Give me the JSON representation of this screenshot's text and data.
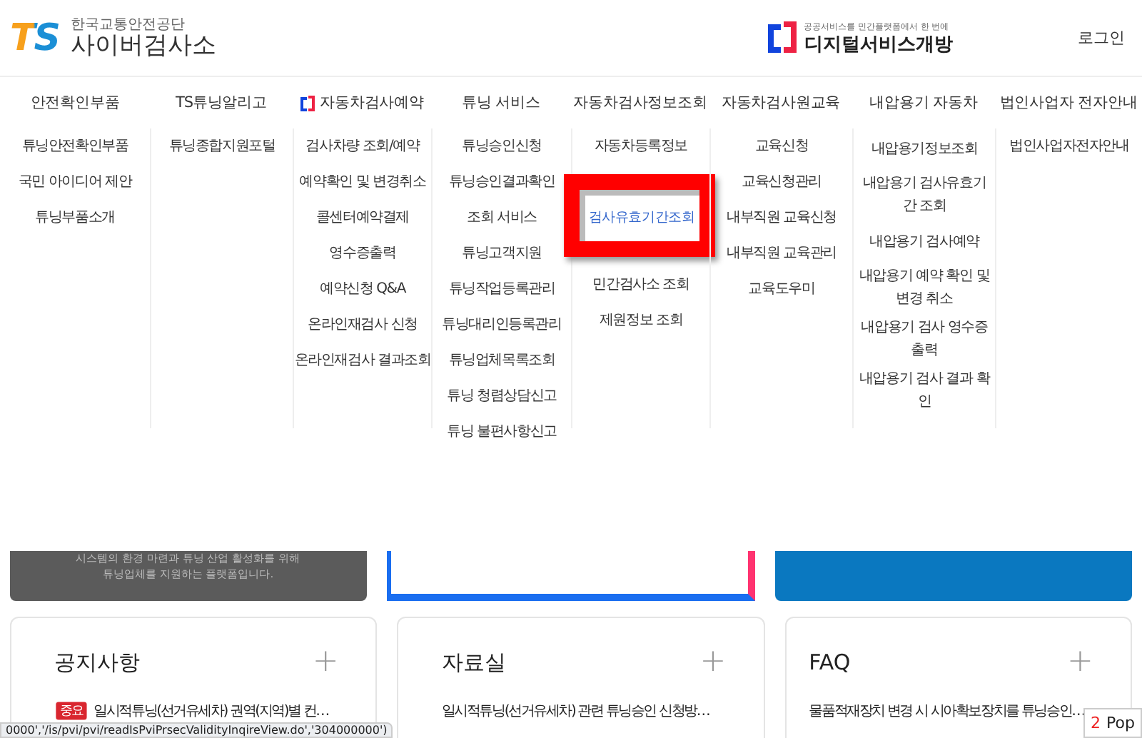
{
  "header": {
    "logo": "TS",
    "org": "한국교통안전공단",
    "site": "사이버검사소",
    "partner": {
      "tagline": "공공서비스를 민간플랫폼에서 한 번에",
      "name": "디지털서비스개방"
    },
    "login": "로그인"
  },
  "nav": [
    {
      "label": "안전확인부품",
      "has_icon": false
    },
    {
      "label": "TS튜닝알리고",
      "has_icon": false
    },
    {
      "label": "자동차검사예약",
      "has_icon": true
    },
    {
      "label": "튜닝 서비스",
      "has_icon": false
    },
    {
      "label": "자동차검사정보조회",
      "has_icon": false
    },
    {
      "label": "자동차검사원교육",
      "has_icon": false
    },
    {
      "label": "내압용기 자동차",
      "has_icon": false
    },
    {
      "label": "법인사업자 전자안내",
      "has_icon": false
    }
  ],
  "menu": [
    {
      "items": [
        {
          "label": "튜닝안전확인부품",
          "highlighted": false
        },
        {
          "label": "국민 아이디어 제안",
          "highlighted": false
        },
        {
          "label": "튜닝부품소개",
          "highlighted": false
        }
      ]
    },
    {
      "items": [
        {
          "label": "튜닝종합지원포털",
          "highlighted": false
        }
      ]
    },
    {
      "items": [
        {
          "label": "검사차량 조회/예약",
          "highlighted": false
        },
        {
          "label": "예약확인 및 변경취소",
          "highlighted": false
        },
        {
          "label": "콜센터예약결제",
          "highlighted": false
        },
        {
          "label": "영수증출력",
          "highlighted": false
        },
        {
          "label": "예약신청 Q&A",
          "highlighted": false
        },
        {
          "label": "온라인재검사 신청",
          "highlighted": false
        },
        {
          "label": "온라인재검사 결과조회",
          "highlighted": false
        }
      ]
    },
    {
      "items": [
        {
          "label": "튜닝승인신청",
          "highlighted": false
        },
        {
          "label": "튜닝승인결과확인",
          "highlighted": false
        },
        {
          "label": "조회 서비스",
          "highlighted": false
        },
        {
          "label": "튜닝고객지원",
          "highlighted": false
        },
        {
          "label": "튜닝작업등록관리",
          "highlighted": false
        },
        {
          "label": "튜닝대리인등록관리",
          "highlighted": false
        },
        {
          "label": "튜닝업체목록조회",
          "highlighted": false
        },
        {
          "label": "튜닝 청렴상담신고",
          "highlighted": false
        },
        {
          "label": "튜닝 불편사항신고",
          "highlighted": false
        }
      ]
    },
    {
      "items": [
        {
          "label": "자동차등록정보",
          "highlighted": false
        },
        {
          "label": "검사유효기간조회",
          "highlighted": true
        },
        {
          "label": "민간검사소 조회",
          "highlighted": false
        },
        {
          "label": "제원정보 조회",
          "highlighted": false
        }
      ]
    },
    {
      "items": [
        {
          "label": "교육신청",
          "highlighted": false
        },
        {
          "label": "교육신청관리",
          "highlighted": false
        },
        {
          "label": "내부직원 교육신청",
          "highlighted": false
        },
        {
          "label": "내부직원 교육관리",
          "highlighted": false
        },
        {
          "label": "교육도우미",
          "highlighted": false
        }
      ]
    },
    {
      "items": [
        {
          "label": "내압용기정보조회",
          "highlighted": false
        },
        {
          "label": "내압용기 검사유효기간 조회",
          "highlighted": false
        },
        {
          "label": "내압용기 검사예약",
          "highlighted": false
        },
        {
          "label": "내압용기 예약 확인 및 변경 취소",
          "highlighted": false
        },
        {
          "label": "내압용기 검사 영수증 출력",
          "highlighted": false
        },
        {
          "label": "내압용기 검사 결과 확인",
          "highlighted": false
        }
      ]
    },
    {
      "items": [
        {
          "label": "법인사업자전자안내",
          "highlighted": false
        }
      ]
    }
  ],
  "banners": [
    {
      "kind": "dark",
      "lines": [
        "시스템의 환경 마련과 튜닝 산업 활성화를 위해",
        "튜닝업체를 지원하는 플랫폼입니다."
      ]
    },
    {
      "kind": "outline"
    },
    {
      "kind": "blue"
    }
  ],
  "boards": [
    {
      "title": "공지사항",
      "more": "+",
      "items": [
        {
          "badge": "중요",
          "text": "일시적튜닝(선거유세차) 권역(지역)별 컨…"
        }
      ]
    },
    {
      "title": "자료실",
      "more": "+",
      "items": [
        {
          "text": "일시적튜닝(선거유세차) 관련 튜닝승인 신청방…"
        }
      ]
    },
    {
      "title": "FAQ",
      "more": "+",
      "items": [
        {
          "text": "물품적재장치 변경 시 시아확보장치를 튜닝승인…"
        }
      ]
    }
  ],
  "status_url": "0000','/is/pvi/pvi/readIsPviPrsecValidityInqireView.do','304000000')",
  "popup": {
    "count": "2",
    "label": "Pop"
  }
}
